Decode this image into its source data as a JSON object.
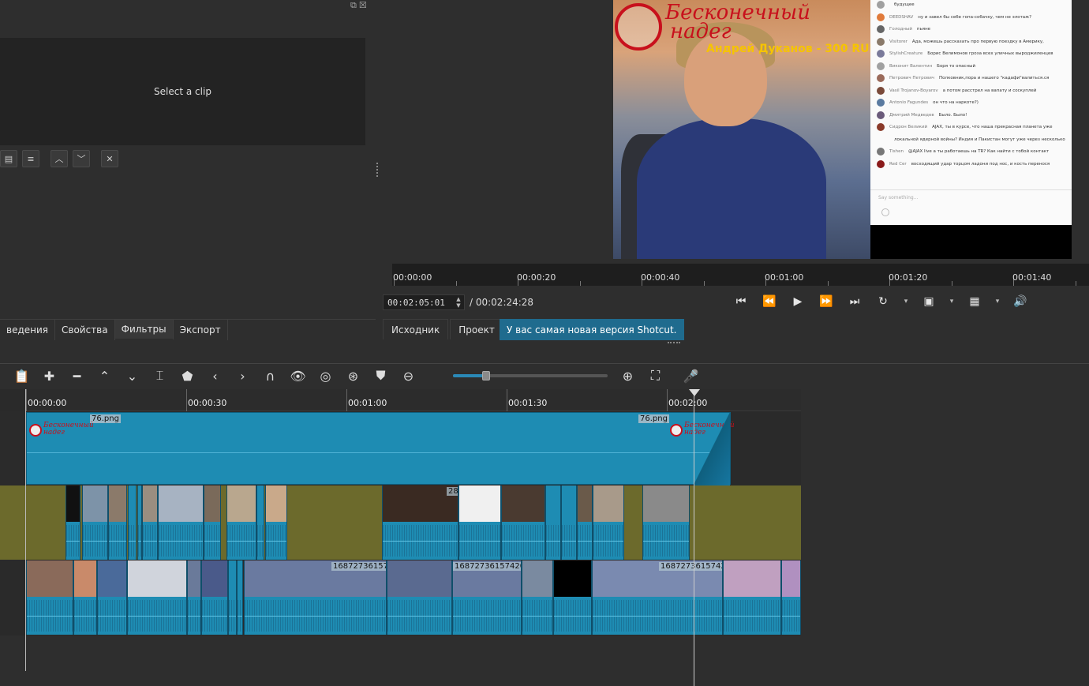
{
  "filters_panel": {
    "placeholder": "Select a clip"
  },
  "left_tabs": [
    "ведения",
    "Свойства",
    "Фильтры",
    "Экспорт"
  ],
  "preview": {
    "overlay_title_line1": "Бесконечный",
    "overlay_title_line2": "надег",
    "overlay_subtitle": "Андрей Дуканов - 300 RUB",
    "chat_messages": [
      {
        "user": "",
        "text": "будущее"
      },
      {
        "user": "DEEDSHAV",
        "text": "ну и завел бы себе гопа-собачку, чем не элотаж?"
      },
      {
        "user": "Голодный",
        "text": "пьяне"
      },
      {
        "user": "Visitorer",
        "text": "Ада, можешь рассказать про первую поездку в Америку,"
      },
      {
        "user": "StylishCreature",
        "text": "Борис Велимонов гроза всех уличных выроджиленцев"
      },
      {
        "user": "Виконит Валентин",
        "text": "Боря то опасный"
      },
      {
        "user": "Петрович Петрович",
        "text": "Полковник,пора и нашего \"кадафи\"валиться.ся"
      },
      {
        "user": "Vasil Trojanov-Boyarov",
        "text": "а потом расстрел на вапату и соскуплей"
      },
      {
        "user": "Antonio Fagundes",
        "text": "он что на наркоте?)"
      },
      {
        "user": "Дмитрий Медведев",
        "text": "Было. Было!"
      },
      {
        "user": "Сидрон Великий",
        "text": "AJAX, ты в курсе, что наша прекрасная планета уже"
      },
      {
        "user": "",
        "text": "локальной ядерной войны? Индия и Пакистан могут уже через несколько"
      },
      {
        "user": "Tishen",
        "text": "@AJAX live а ты работаешь на TR? Как найти с тобой контакт"
      },
      {
        "user": "Red Cer",
        "text": "восходящий удар торцом ладони под нос, и кость перенося"
      }
    ],
    "chat_input_placeholder": "Say something..."
  },
  "ruler_labels": [
    "00:00:00",
    "00:00:20",
    "00:00:40",
    "00:01:00",
    "00:01:20",
    "00:01:40"
  ],
  "timecode": {
    "current": "00:02:05:01",
    "total": "/ 00:02:24:28"
  },
  "source_tabs": [
    "Исходник",
    "Проект"
  ],
  "status_message": "У вас самая новая версия Shotcut.",
  "timeline": {
    "ruler_labels": [
      "00:00:00",
      "00:00:30",
      "00:01:00",
      "00:01:30",
      "00:02:00"
    ],
    "png_clip_label": "76.png",
    "png_clip_label_end": "76.png",
    "clip_labels": [
      "28",
      "168727361574",
      "16872736157420.",
      "1687273615742"
    ],
    "zoom_level": 0.2
  },
  "colors": {
    "accent": "#1f6b8e",
    "clip": "#1e8cb3",
    "track_blank": "#6c6a2c"
  }
}
